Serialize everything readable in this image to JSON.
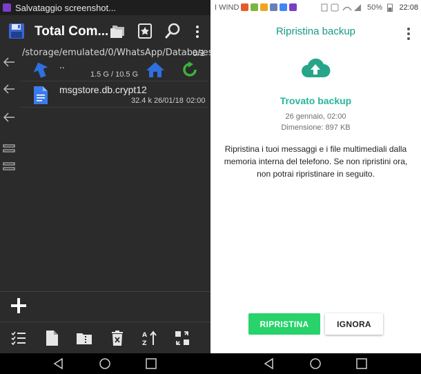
{
  "left": {
    "status": {
      "notification": "Salvataggio screenshot..."
    },
    "toolbar": {
      "title": "Total Com..."
    },
    "path": "/storage/emulated/0/WhatsApp/Databases",
    "count": "0/1",
    "parent": {
      "name": "..",
      "space": "1.5 G / 10.5 G"
    },
    "file": {
      "name": "msgstore.db.crypt12",
      "size": "32.4 k",
      "date": "26/01/18",
      "time": "02:00"
    }
  },
  "right": {
    "status": {
      "carrier": "I WIND",
      "battery": "50%",
      "time": "22:08"
    },
    "title": "Ripristina backup",
    "found": "Trovato backup",
    "date": "26 gennaio, 02:00",
    "size": "Dimensione: 897 KB",
    "description": "Ripristina i tuoi messaggi e i file multimediali dalla memoria interna del telefono. Se non ripristini ora, non potrai ripristinare in seguito.",
    "buttons": {
      "restore": "RIPRISTINA",
      "ignore": "IGNORA"
    }
  },
  "colors": {
    "tc_background": "#2b2b2b",
    "whatsapp_teal": "#159a84",
    "whatsapp_green": "#27d36a",
    "folder_blue": "#2f6fe0",
    "refresh_green": "#3bb33b"
  },
  "icons": {
    "left_toolbar": [
      "save-icon",
      "folders-icon",
      "bookmark-star-icon",
      "search-icon",
      "more-vert-icon"
    ],
    "left_tools": [
      "select-icon",
      "new-file-icon",
      "zip-icon",
      "delete-icon",
      "sort-icon",
      "swap-icon"
    ],
    "nav": [
      "back-icon",
      "home-icon",
      "recents-icon"
    ]
  }
}
